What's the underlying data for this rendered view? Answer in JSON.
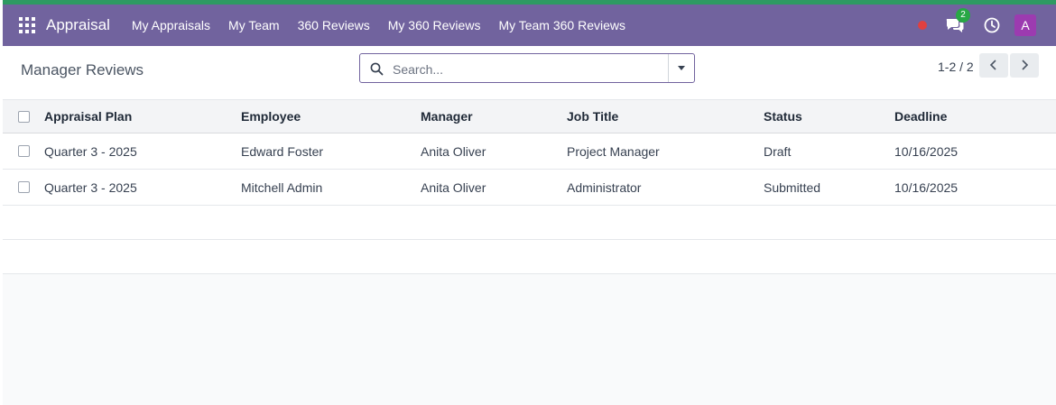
{
  "navbar": {
    "app_name": "Appraisal",
    "menu": [
      "My Appraisals",
      "My Team",
      "360 Reviews",
      "My 360 Reviews",
      "My Team 360 Reviews"
    ],
    "message_count": "2",
    "avatar_letter": "A",
    "accent_color": "#71639e",
    "badge_color": "#28a745",
    "avatar_color": "#9c3bb0",
    "icons": [
      "apps-grid-icon",
      "recording-dot-icon",
      "chat-bubbles-icon",
      "clock-icon"
    ]
  },
  "control_panel": {
    "title": "Manager Reviews",
    "search_placeholder": "Search...",
    "pager": "1-2 / 2",
    "icons": [
      "search-icon",
      "caret-down-icon",
      "chevron-left-icon",
      "chevron-right-icon"
    ]
  },
  "table": {
    "columns": [
      "Appraisal Plan",
      "Employee",
      "Manager",
      "Job Title",
      "Status",
      "Deadline"
    ],
    "rows": [
      [
        "Quarter 3 - 2025",
        "Edward Foster",
        "Anita Oliver",
        "Project Manager",
        "Draft",
        "10/16/2025"
      ],
      [
        "Quarter 3 - 2025",
        "Mitchell Admin",
        "Anita Oliver",
        "Administrator",
        "Submitted",
        "10/16/2025"
      ]
    ]
  }
}
